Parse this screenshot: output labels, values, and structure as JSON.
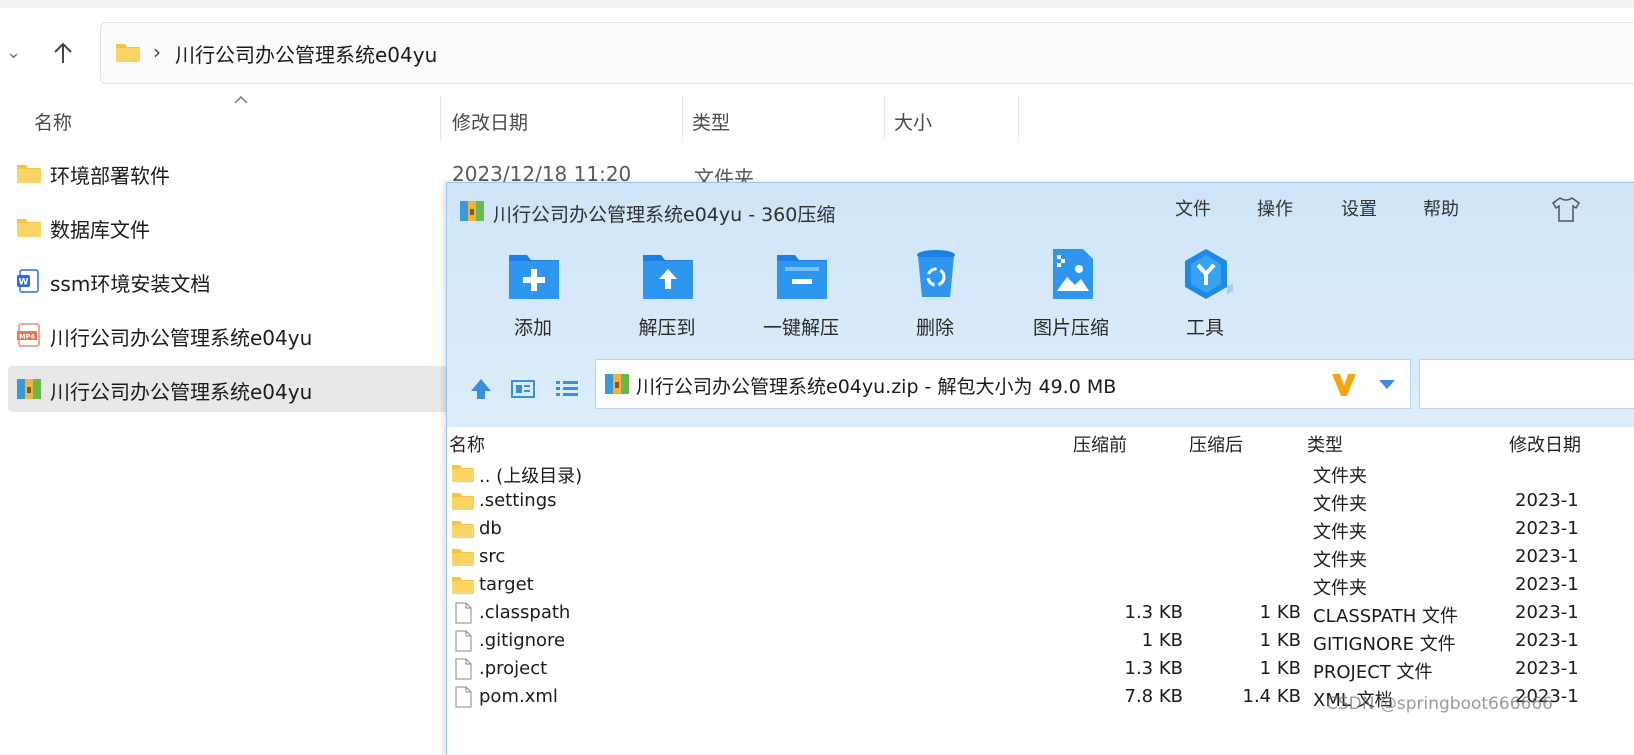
{
  "explorer": {
    "breadcrumb": "川行公司办公管理系统e04yu",
    "breadcrumb_sep": "›",
    "columns": {
      "name": "名称",
      "modified": "修改日期",
      "type": "类型",
      "size": "大小"
    },
    "items": [
      {
        "name": "环境部署软件",
        "icon": "folder-icon",
        "date": "2023/12/18 11:20",
        "type": "文件夹"
      },
      {
        "name": "数据库文件",
        "icon": "folder-icon"
      },
      {
        "name": "ssm环境安装文档",
        "icon": "word-doc-icon"
      },
      {
        "name": "川行公司办公管理系统e04yu",
        "icon": "mp4-file-icon"
      },
      {
        "name": "川行公司办公管理系统e04yu",
        "icon": "zip-archive-icon",
        "selected": true
      }
    ]
  },
  "zip_window": {
    "title": "川行公司办公管理系统e04yu - 360压缩",
    "menu": [
      "文件",
      "操作",
      "设置",
      "帮助"
    ],
    "toolbar": [
      {
        "label": "添加",
        "icon": "add-icon"
      },
      {
        "label": "解压到",
        "icon": "extract-to-icon"
      },
      {
        "label": "一键解压",
        "icon": "one-click-extract-icon"
      },
      {
        "label": "删除",
        "icon": "delete-icon"
      },
      {
        "label": "图片压缩",
        "icon": "image-compress-icon"
      },
      {
        "label": "工具",
        "icon": "tools-icon"
      }
    ],
    "path": "川行公司办公管理系统e04yu.zip - 解包大小为 49.0 MB",
    "columns": {
      "name": "名称",
      "before": "压缩前",
      "after": "压缩后",
      "type": "类型",
      "modified": "修改日期"
    },
    "rows": [
      {
        "name": ".. (上级目录)",
        "before": "",
        "after": "",
        "type": "文件夹",
        "modified": "",
        "icon": "folder-icon"
      },
      {
        "name": ".settings",
        "before": "",
        "after": "",
        "type": "文件夹",
        "modified": "2023-1",
        "icon": "folder-icon"
      },
      {
        "name": "db",
        "before": "",
        "after": "",
        "type": "文件夹",
        "modified": "2023-1",
        "icon": "folder-icon"
      },
      {
        "name": "src",
        "before": "",
        "after": "",
        "type": "文件夹",
        "modified": "2023-1",
        "icon": "folder-icon"
      },
      {
        "name": "target",
        "before": "",
        "after": "",
        "type": "文件夹",
        "modified": "2023-1",
        "icon": "folder-icon"
      },
      {
        "name": ".classpath",
        "before": "1.3 KB",
        "after": "1 KB",
        "type": "CLASSPATH 文件",
        "modified": "2023-1",
        "icon": "file-icon"
      },
      {
        "name": ".gitignore",
        "before": "1 KB",
        "after": "1 KB",
        "type": "GITIGNORE 文件",
        "modified": "2023-1",
        "icon": "file-icon"
      },
      {
        "name": ".project",
        "before": "1.3 KB",
        "after": "1 KB",
        "type": "PROJECT 文件",
        "modified": "2023-1",
        "icon": "file-icon"
      },
      {
        "name": "pom.xml",
        "before": "7.8 KB",
        "after": "1.4 KB",
        "type": "XML 文档",
        "modified": "2023-1",
        "icon": "file-icon"
      }
    ]
  },
  "watermark": "CSDN @springboot666666",
  "colors": {
    "zip_header": "#d8eafa",
    "accent": "#1e8ae6",
    "folder": "#f7c948"
  }
}
